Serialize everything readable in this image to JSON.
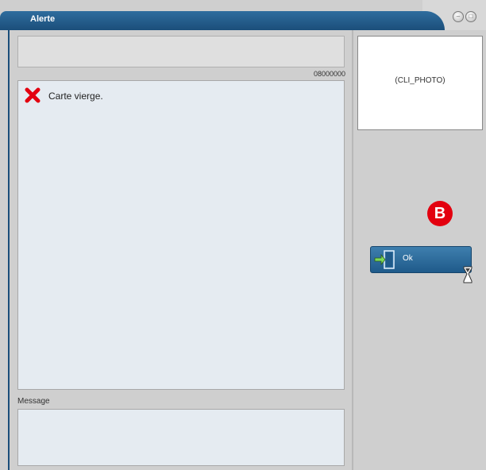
{
  "window": {
    "title": "Alerte"
  },
  "header": {
    "code": "08000000"
  },
  "alert": {
    "icon": "error-x-icon",
    "message": "Carte vierge."
  },
  "message_section": {
    "label": "Message",
    "value": ""
  },
  "photo": {
    "placeholder": "(CLI_PHOTO)"
  },
  "badge": {
    "label": "B",
    "color": "#e3000f"
  },
  "actions": {
    "ok_label": "Ok"
  },
  "colors": {
    "title_bar": "#1b4e7a",
    "panel_bg": "#e5ebf1",
    "window_bg": "#cfcfcf"
  }
}
